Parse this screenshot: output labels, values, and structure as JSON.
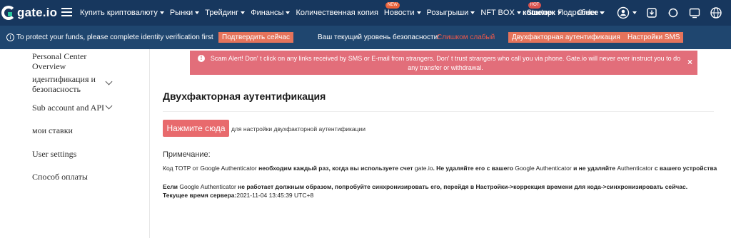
{
  "nav": {
    "logo": "gate.io",
    "items": [
      {
        "label": "Купить криптовалюту",
        "caret": true,
        "badge": ""
      },
      {
        "label": "Рынки",
        "caret": true,
        "badge": ""
      },
      {
        "label": "Трейдинг",
        "caret": true,
        "badge": ""
      },
      {
        "label": "Финансы",
        "caret": true,
        "badge": ""
      },
      {
        "label": "Количественная копия",
        "caret": false,
        "badge": ""
      },
      {
        "label": "Новости",
        "caret": true,
        "badge": "NEW"
      },
      {
        "label": "Розыгрыши",
        "caret": true,
        "badge": ""
      },
      {
        "label": "NFT BOX",
        "caret": true,
        "badge": ""
      },
      {
        "label": "Startup",
        "caret": false,
        "badge": "HOT"
      },
      {
        "label": "Подробнее",
        "caret": true,
        "badge": ""
      }
    ],
    "wallet": "кошелек",
    "order": "Order",
    "icons": [
      "user-icon",
      "download-icon",
      "support-icon",
      "message-icon",
      "globe-icon"
    ]
  },
  "security_bar": {
    "message": "To protect your funds, please complete identity verification first",
    "verify_button": "Подтвердить сейчас",
    "level_label": "Ваш текущий уровень безопасности:",
    "level_value": "Слишком слабый",
    "twofa_button": "Двухфакторная аутентификация",
    "sms_button": "Настройки SMS"
  },
  "sidebar": {
    "items": [
      {
        "label": "Personal Center Overview"
      },
      {
        "label": "идентификация и безопасность"
      },
      {
        "label": "Sub account and API"
      },
      {
        "label": "мои ставки"
      },
      {
        "label": "User settings"
      },
      {
        "label": "Способ оплаты"
      }
    ]
  },
  "alert": {
    "text": "Scam Alert! Don' t click on any links received by SMS or E-mail from strangers. Don' t trust strangers who call you via phone. Gate.io will never ever instruct you to do any transfer or withdrawal."
  },
  "main": {
    "title": "Двухфакторная аутентификация",
    "cta_button": "Нажмите сюда",
    "cta_desc": "для настройки двухфакторной аутентификации",
    "note_title": "Примечание:",
    "note1": {
      "p1": "Код TOTP от ",
      "p2": "Google Authenticator",
      "p3": " необходим каждый раз, когда вы используете счет ",
      "p4": "gate.io",
      "p5": ". Не удаляйте его с вашего ",
      "p6": "Google Authenticator",
      "p7": " и не удаляйте ",
      "p8": "Authenticator",
      "p9": " с вашего устройства"
    },
    "note2": {
      "p1": "Если ",
      "p2": "Google Authenticator",
      "p3": " не работает должным образом, попробуйте синхронизировать его, перейдя в Настройки->коррекция времени для кода->синхронизировать сейчас."
    },
    "server_time_label": "Текущее время сервера:",
    "server_time_value": "2021-11-04 13:45:39 UTC+8"
  },
  "colors": {
    "nav_bg": "#17375e",
    "security_bar_bg": "#1f466f",
    "accent_button": "#e5735b",
    "alert_bg": "#e26e7a",
    "danger_text": "#f0584a",
    "cta_bg": "#e86a6d"
  }
}
